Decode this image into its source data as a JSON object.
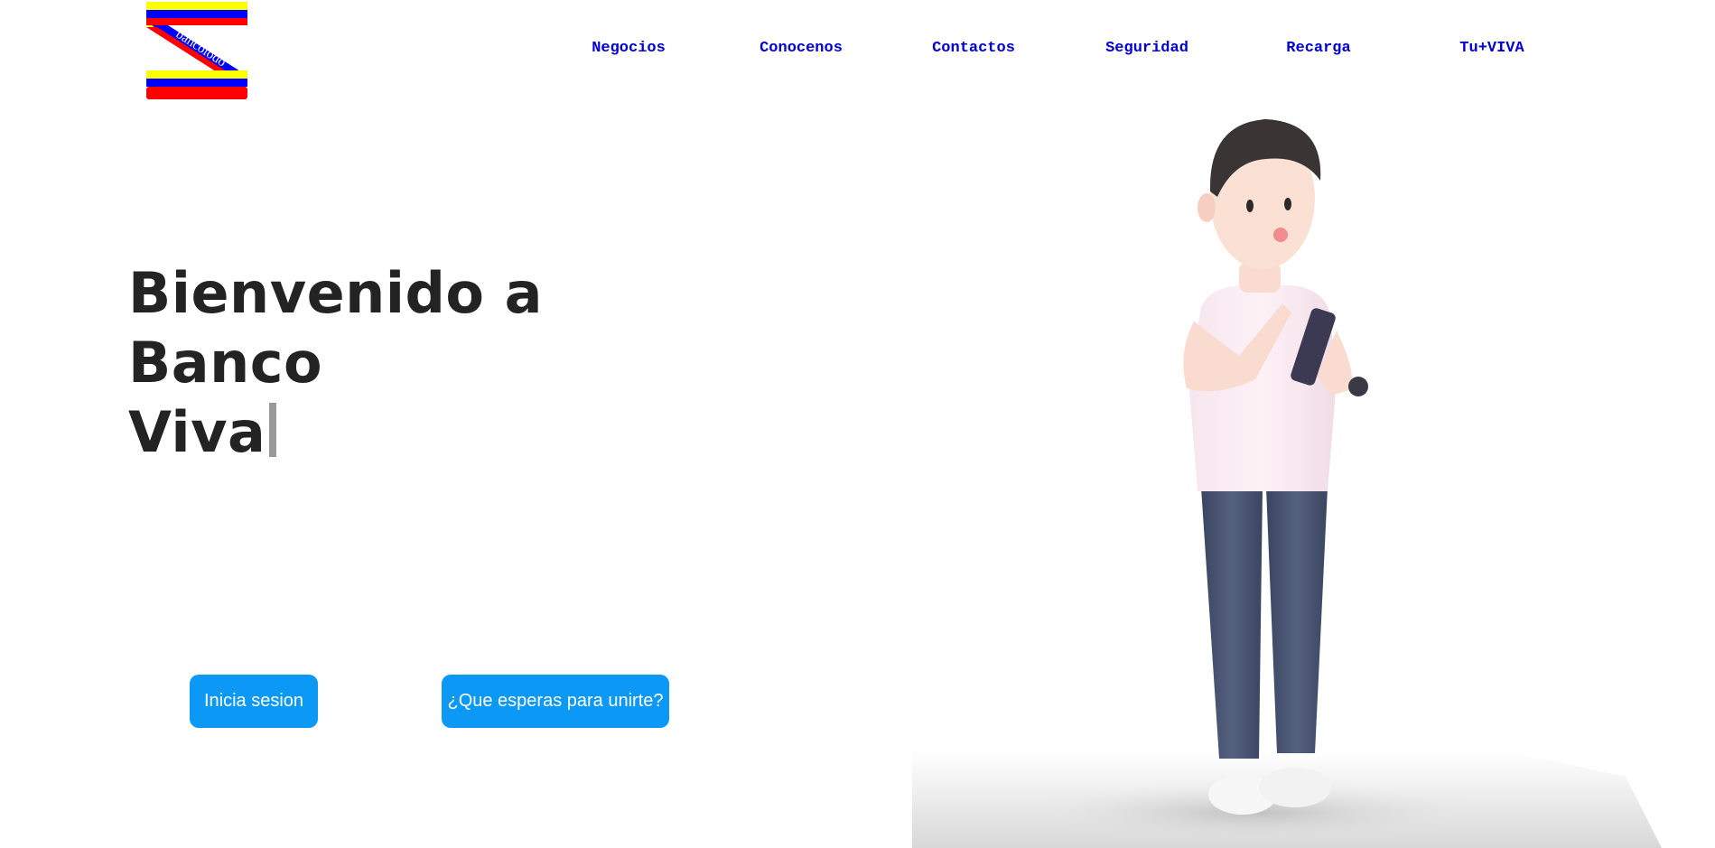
{
  "nav": {
    "items": [
      {
        "label": "Negocios"
      },
      {
        "label": "Conocenos"
      },
      {
        "label": "Contactos"
      },
      {
        "label": "Seguridad"
      },
      {
        "label": "Recarga"
      },
      {
        "label": "Tu+VIVA"
      }
    ]
  },
  "logo": {
    "text": "bancolodo",
    "colors": [
      "#ffff00",
      "#0000ff",
      "#ff0000"
    ]
  },
  "hero": {
    "title_line1": "Bienvenido a Banco",
    "title_line2": "Viva"
  },
  "buttons": {
    "login_label": "Inicia sesion",
    "join_label": "¿Que esperas para unirte?"
  },
  "colors": {
    "nav_link": "#0000d4",
    "button": "#0c98f5",
    "title": "#232323"
  }
}
